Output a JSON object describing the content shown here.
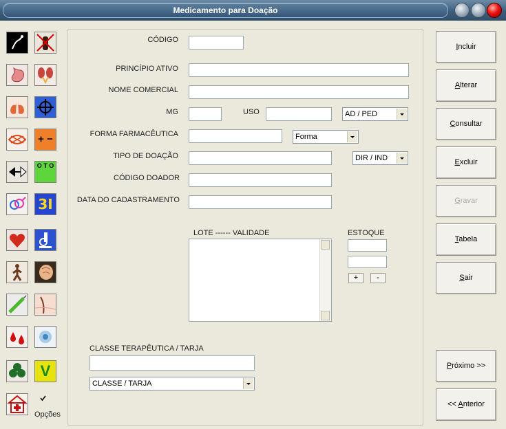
{
  "window": {
    "title": "Medicamento para Doação"
  },
  "sidebar": {
    "checkbox_checked": true,
    "options_label": "Opções",
    "tiles": [
      {
        "name": "bones-icon"
      },
      {
        "name": "no-drink-icon"
      },
      {
        "name": "stomach-icon"
      },
      {
        "name": "kidneys-icon"
      },
      {
        "name": "lungs-icon"
      },
      {
        "name": "crosshair-icon"
      },
      {
        "name": "eye-icon"
      },
      {
        "name": "plus-minus-icon",
        "text": "+ −"
      },
      {
        "name": "arrow-connector-icon"
      },
      {
        "name": "oto-icon",
        "text": "O T O"
      },
      {
        "name": "gender-icon"
      },
      {
        "name": "3i-icon",
        "text": "3I"
      },
      {
        "name": "heart-icon"
      },
      {
        "name": "microscope-icon"
      },
      {
        "name": "evolution-icon"
      },
      {
        "name": "brain-icon"
      },
      {
        "name": "syringe-icon"
      },
      {
        "name": "skin-icon"
      },
      {
        "name": "blood-drops-icon"
      },
      {
        "name": "cell-icon"
      },
      {
        "name": "clover-icon"
      },
      {
        "name": "v-icon",
        "text": "V"
      },
      {
        "name": "hospital-icon"
      }
    ]
  },
  "form": {
    "codigo_label": "CÓDIGO",
    "principio_label": "PRINCÍPIO ATIVO",
    "nome_label": "NOME COMERCIAL",
    "mg_label": "MG",
    "uso_label": "USO",
    "uso_select": "AD / PED",
    "forma_label": "FORMA FARMACÊUTICA",
    "forma_select": "Forma",
    "tipo_label": "TIPO DE DOAÇÃO",
    "tipo_select": "DIR / IND",
    "doador_label": "CÓDIGO DOADOR",
    "data_label": "DATA DO CADASTRAMENTO",
    "lote_header": "LOTE ------  VALIDADE",
    "estoque_label": "ESTOQUE",
    "plus_label": "+",
    "minus_label": "-",
    "classe_label": "CLASSE TERAPÊUTICA / TARJA",
    "classe_select": "CLASSE / TARJA"
  },
  "buttons": {
    "incluir": {
      "pre": "",
      "u": "I",
      "post": "ncluir"
    },
    "alterar": {
      "pre": "",
      "u": "A",
      "post": "lterar"
    },
    "consultar": {
      "pre": "",
      "u": "C",
      "post": "onsultar"
    },
    "excluir": {
      "pre": "",
      "u": "E",
      "post": "xcluir"
    },
    "gravar": {
      "pre": "",
      "u": "G",
      "post": "ravar"
    },
    "tabela": {
      "pre": "",
      "u": "T",
      "post": "abela"
    },
    "sair": {
      "pre": "",
      "u": "S",
      "post": "air"
    },
    "proximo": {
      "pre": "",
      "u": "P",
      "post": "róximo >>"
    },
    "anterior": {
      "pre": "<< ",
      "u": "A",
      "post": "nterior"
    }
  }
}
